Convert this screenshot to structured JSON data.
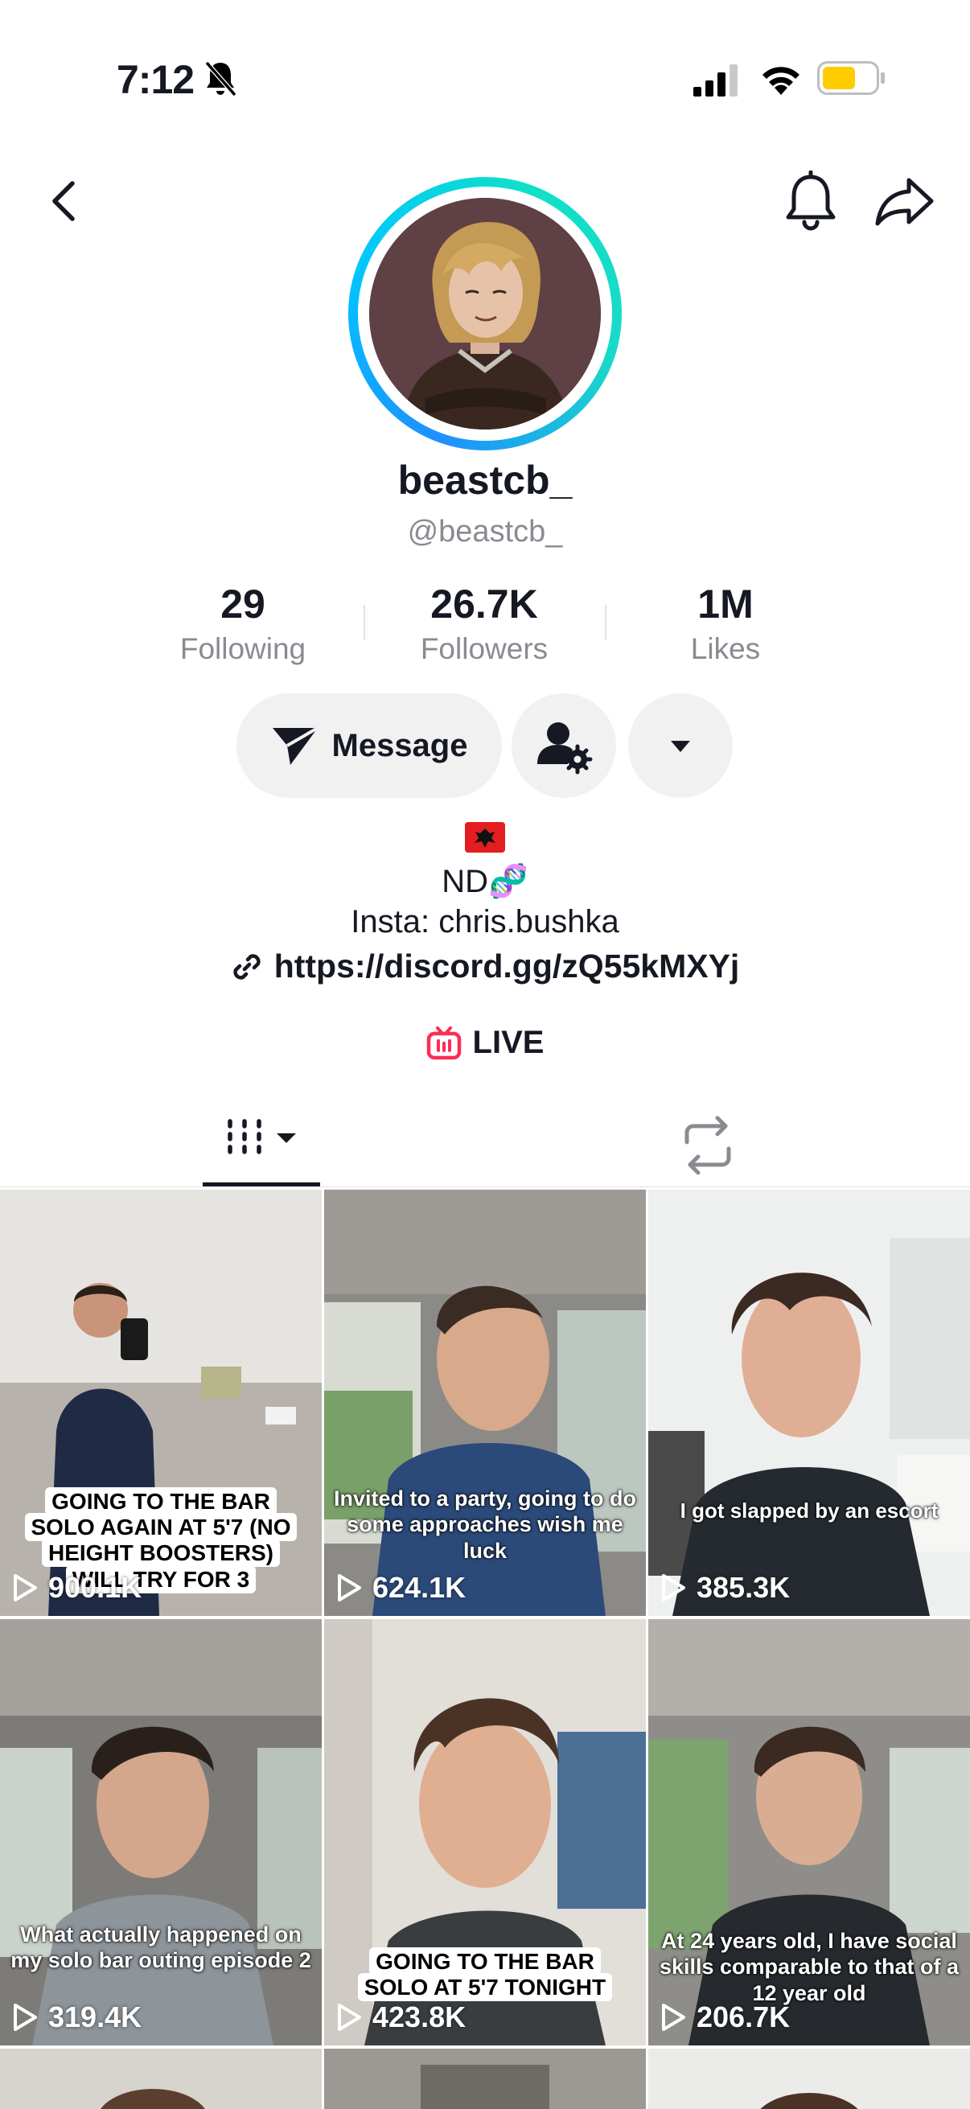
{
  "status_bar": {
    "time": "7:12",
    "battery_color": "#FFCC00"
  },
  "profile": {
    "display_name": "beastcb_",
    "handle": "@beastcb_",
    "ring_colors": [
      "#1E90FF",
      "#11E0C8"
    ]
  },
  "stats": [
    {
      "value": "29",
      "label": "Following"
    },
    {
      "value": "26.7K",
      "label": "Followers"
    },
    {
      "value": "1M",
      "label": "Likes"
    }
  ],
  "actions": {
    "message_label": "Message"
  },
  "bio": {
    "line1": "ND🧬",
    "line2": "Insta: chris.bushka",
    "link": "https://discord.gg/zQ55kMXYj",
    "live_label": "LIVE",
    "live_color": "#FE2C55"
  },
  "videos": [
    {
      "views": "900.1K",
      "caption": "GOING TO THE BAR SOLO AGAIN AT 5'7 (NO HEIGHT BOOSTERS) WILL TRY FOR 3",
      "style": "box"
    },
    {
      "views": "624.1K",
      "caption": "Invited to a party, going to do some approaches wish me luck",
      "style": "plain"
    },
    {
      "views": "385.3K",
      "caption": "I got slapped by an escort",
      "style": "plain"
    },
    {
      "views": "319.4K",
      "caption": "What actually happened on my solo bar outing episode 2",
      "style": "plain"
    },
    {
      "views": "423.8K",
      "caption": "GOING TO THE BAR SOLO AT 5'7 TONIGHT",
      "style": "box"
    },
    {
      "views": "206.7K",
      "caption": "At 24 years old, I have social skills comparable to that of a 12 year old",
      "style": "plain"
    }
  ]
}
